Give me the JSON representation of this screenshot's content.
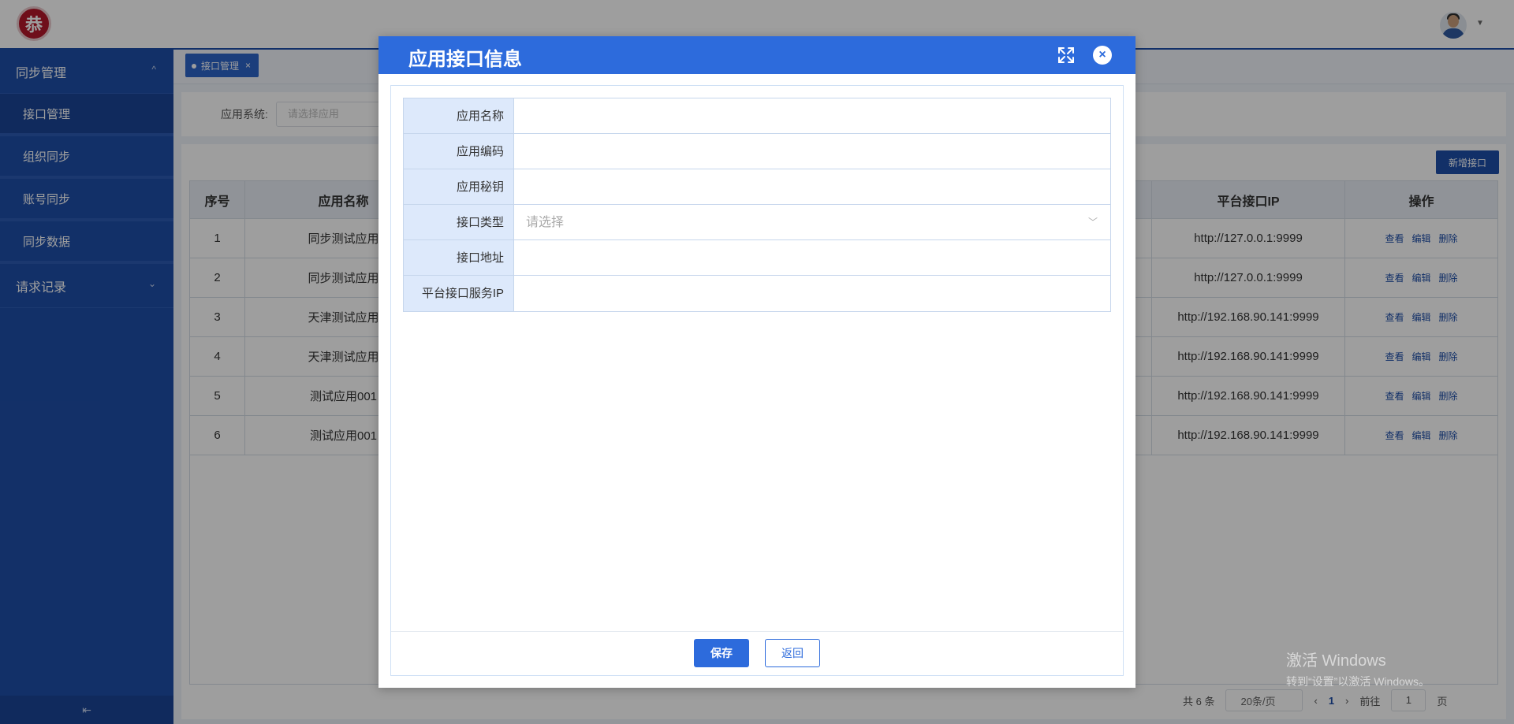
{
  "header": {
    "logo_text": "恭"
  },
  "sidebar": {
    "groups": [
      {
        "label": "同步管理",
        "chevron": "^"
      },
      {
        "label": "请求记录",
        "chevron": "⌄"
      }
    ],
    "items": [
      {
        "label": "接口管理"
      },
      {
        "label": "组织同步"
      },
      {
        "label": "账号同步"
      },
      {
        "label": "同步数据"
      }
    ],
    "collapse_glyph": "⇤"
  },
  "tabs": [
    {
      "label": "接口管理",
      "close": "×"
    }
  ],
  "search": {
    "label": "应用系统:",
    "placeholder": "请选择应用"
  },
  "toolbar": {
    "add_label": "新增接口"
  },
  "table": {
    "headers": [
      "序号",
      "应用名称",
      "平台接口IP",
      "操作"
    ],
    "rows": [
      {
        "no": "1",
        "name": "同步测试应用",
        "ip": "http://127.0.0.1:9999"
      },
      {
        "no": "2",
        "name": "同步测试应用",
        "ip": "http://127.0.0.1:9999"
      },
      {
        "no": "3",
        "name": "天津测试应用",
        "ip": "http://192.168.90.141:9999"
      },
      {
        "no": "4",
        "name": "天津测试应用",
        "ip": "http://192.168.90.141:9999"
      },
      {
        "no": "5",
        "name": "测试应用001",
        "ip": "http://192.168.90.141:9999"
      },
      {
        "no": "6",
        "name": "测试应用001",
        "ip": "http://192.168.90.141:9999"
      }
    ],
    "ops": {
      "view": "查看",
      "edit": "编辑",
      "delete": "删除"
    }
  },
  "pager": {
    "total": "共 6 条",
    "size": "20条/页",
    "prev": "‹",
    "current": "1",
    "next": "›",
    "goto_label": "前往",
    "goto_value": "1",
    "page_unit": "页"
  },
  "dialog": {
    "title": "应用接口信息",
    "close_glyph": "×",
    "fields": [
      {
        "label": "应用名称",
        "value": ""
      },
      {
        "label": "应用编码",
        "value": ""
      },
      {
        "label": "应用秘钥",
        "value": ""
      },
      {
        "label": "接口类型",
        "value": "请选择"
      },
      {
        "label": "接口地址",
        "value": ""
      },
      {
        "label": "平台接口服务IP",
        "value": ""
      }
    ],
    "select_caret": "﹀",
    "save_label": "保存",
    "back_label": "返回"
  },
  "watermark": {
    "line1": "激活 Windows",
    "line2": "转到“设置”以激活 Windows。"
  },
  "colors": {
    "sidebar": "#1e4ea8",
    "dialog_header": "#2d6bdc",
    "label_bg": "#dde9fb"
  }
}
